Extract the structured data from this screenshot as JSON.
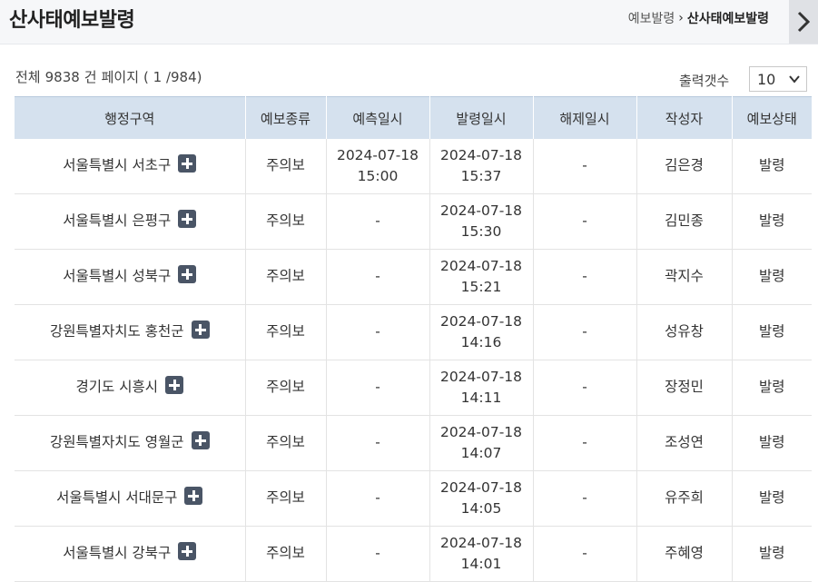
{
  "header": {
    "title": "산사태예보발령",
    "breadcrumb": [
      "예보발령",
      "산사태예보발령"
    ],
    "breadcrumb_sep": "›"
  },
  "summary": {
    "total_label": "전체",
    "total": "9838",
    "total_unit": "건",
    "page_label": "페이지",
    "page": "( 1 /984)"
  },
  "page_size": {
    "label": "출력갯수",
    "value": "10"
  },
  "table": {
    "columns": [
      "행정구역",
      "예보종류",
      "예측일시",
      "발령일시",
      "해제일시",
      "작성자",
      "예보상태"
    ],
    "rows": [
      {
        "region": "서울특별시 서초구",
        "type": "주의보",
        "pred_date": "2024-07-18",
        "pred_time": "15:00",
        "issue_date": "2024-07-18",
        "issue_time": "15:37",
        "release": "-",
        "author": "김은경",
        "status": "발령"
      },
      {
        "region": "서울특별시 은평구",
        "type": "주의보",
        "pred_date": "-",
        "pred_time": "",
        "issue_date": "2024-07-18",
        "issue_time": "15:30",
        "release": "-",
        "author": "김민종",
        "status": "발령"
      },
      {
        "region": "서울특별시 성북구",
        "type": "주의보",
        "pred_date": "-",
        "pred_time": "",
        "issue_date": "2024-07-18",
        "issue_time": "15:21",
        "release": "-",
        "author": "곽지수",
        "status": "발령"
      },
      {
        "region": "강원특별자치도 홍천군",
        "type": "주의보",
        "pred_date": "-",
        "pred_time": "",
        "issue_date": "2024-07-18",
        "issue_time": "14:16",
        "release": "-",
        "author": "성유창",
        "status": "발령"
      },
      {
        "region": "경기도 시흥시",
        "type": "주의보",
        "pred_date": "-",
        "pred_time": "",
        "issue_date": "2024-07-18",
        "issue_time": "14:11",
        "release": "-",
        "author": "장정민",
        "status": "발령"
      },
      {
        "region": "강원특별자치도 영월군",
        "type": "주의보",
        "pred_date": "-",
        "pred_time": "",
        "issue_date": "2024-07-18",
        "issue_time": "14:07",
        "release": "-",
        "author": "조성연",
        "status": "발령"
      },
      {
        "region": "서울특별시 서대문구",
        "type": "주의보",
        "pred_date": "-",
        "pred_time": "",
        "issue_date": "2024-07-18",
        "issue_time": "14:05",
        "release": "-",
        "author": "유주희",
        "status": "발령"
      },
      {
        "region": "서울특별시 강북구",
        "type": "주의보",
        "pred_date": "-",
        "pred_time": "",
        "issue_date": "2024-07-18",
        "issue_time": "14:01",
        "release": "-",
        "author": "주혜영",
        "status": "발령"
      }
    ]
  },
  "icons": {
    "expand": "plus-square-icon",
    "next": "chevron-right-icon",
    "dropdown": "chevron-down-icon"
  }
}
